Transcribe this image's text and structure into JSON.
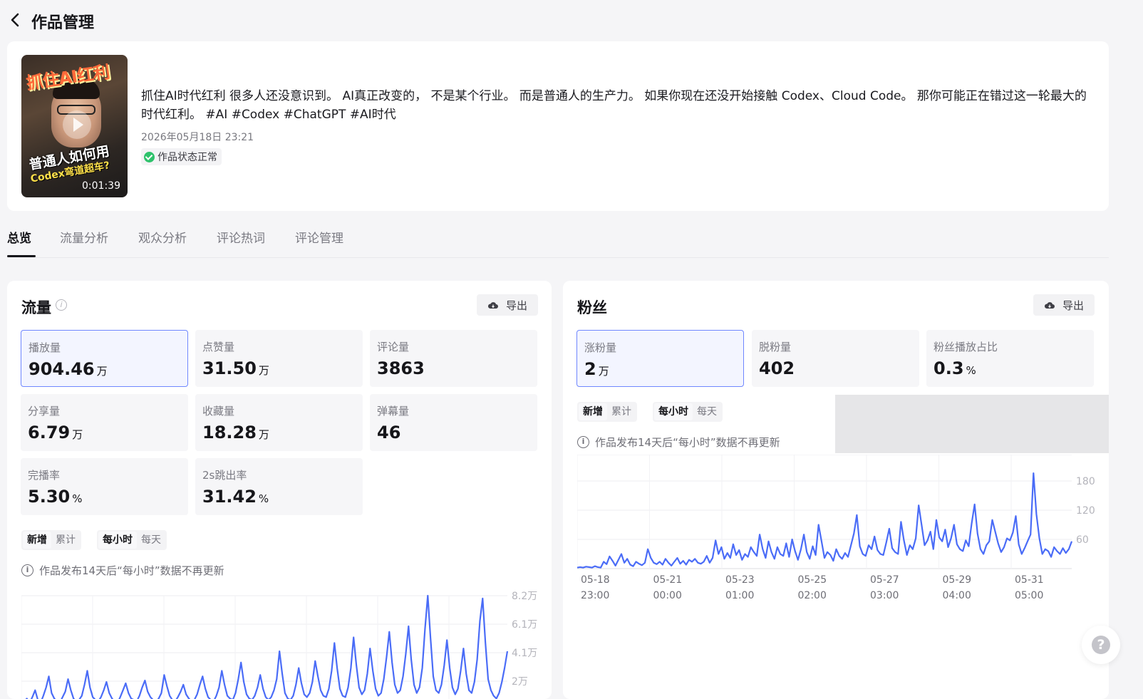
{
  "header": {
    "title": "作品管理"
  },
  "video": {
    "thumbnail": {
      "line1": "抓住AI红利",
      "line2": "普通人如何用",
      "line3": "Codex弯道超车?",
      "duration": "0:01:39"
    },
    "description": "抓住AI时代红利 很多人还没意识到。 AI真正改变的， 不是某个行业。 而是普通人的生产力。 如果你现在还没开始接触 Codex、Cloud Code。 那你可能正在错过这一轮最大的时代红利。 #AI #Codex #ChatGPT #AI时代",
    "published_at": "2026年05月18日 23:21",
    "status": "作品状态正常"
  },
  "tabs": [
    "总览",
    "流量分析",
    "观众分析",
    "评论热词",
    "评论管理"
  ],
  "traffic": {
    "title": "流量",
    "export_label": "导出",
    "metrics": [
      {
        "label": "播放量",
        "value": "904.46",
        "unit": "万"
      },
      {
        "label": "点赞量",
        "value": "31.50",
        "unit": "万"
      },
      {
        "label": "评论量",
        "value": "3863",
        "unit": ""
      },
      {
        "label": "分享量",
        "value": "6.79",
        "unit": "万"
      },
      {
        "label": "收藏量",
        "value": "18.28",
        "unit": "万"
      },
      {
        "label": "弹幕量",
        "value": "46",
        "unit": ""
      },
      {
        "label": "完播率",
        "value": "5.30",
        "unit": "%"
      },
      {
        "label": "2s跳出率",
        "value": "31.42",
        "unit": "%"
      }
    ],
    "toggle_mode": [
      "新增",
      "累计"
    ],
    "toggle_period": [
      "每小时",
      "每天"
    ],
    "notice": "作品发布14天后“每小时”数据不再更新"
  },
  "fans": {
    "title": "粉丝",
    "export_label": "导出",
    "metrics": [
      {
        "label": "涨粉量",
        "value": "2",
        "unit": "万"
      },
      {
        "label": "脱粉量",
        "value": "402",
        "unit": ""
      },
      {
        "label": "粉丝播放占比",
        "value": "0.3",
        "unit": "%"
      }
    ],
    "toggle_mode": [
      "新增",
      "累计"
    ],
    "toggle_period": [
      "每小时",
      "每天"
    ],
    "notice": "作品发布14天后“每小时”数据不再更新"
  },
  "chart_data": [
    {
      "type": "line",
      "y_ticks": [
        "8.2万",
        "6.1万",
        "4.1万",
        "2万"
      ],
      "ylim": [
        0,
        82000
      ],
      "grid": true,
      "color": "#4a6cf7",
      "values": [
        3,
        6,
        8,
        5,
        9,
        14,
        7,
        5,
        10,
        16,
        24,
        12,
        8,
        6,
        5,
        9,
        13,
        22,
        14,
        8,
        6,
        7,
        10,
        18,
        28,
        16,
        9,
        7,
        6,
        9,
        14,
        20,
        12,
        8,
        6,
        5,
        9,
        14,
        19,
        12,
        8,
        7,
        6,
        10,
        16,
        21,
        13,
        9,
        7,
        6,
        8,
        12,
        25,
        17,
        10,
        7,
        6,
        9,
        13,
        18,
        11,
        8,
        6,
        7,
        11,
        18,
        24,
        15,
        9,
        7,
        6,
        10,
        16,
        28,
        18,
        10,
        8,
        7,
        12,
        22,
        34,
        20,
        11,
        8,
        7,
        10,
        16,
        25,
        15,
        9,
        7,
        9,
        14,
        22,
        42,
        26,
        12,
        8,
        7,
        10,
        18,
        30,
        19,
        11,
        9,
        12,
        20,
        35,
        24,
        14,
        10,
        9,
        15,
        28,
        48,
        30,
        15,
        10,
        9,
        16,
        30,
        52,
        32,
        16,
        11,
        14,
        26,
        44,
        28,
        15,
        10,
        12,
        22,
        38,
        56,
        34,
        18,
        12,
        14,
        24,
        40,
        60,
        36,
        18,
        12,
        16,
        30,
        58,
        82,
        52,
        24,
        14,
        12,
        18,
        32,
        50,
        30,
        16,
        11,
        15,
        28,
        44,
        26,
        14,
        12,
        20,
        36,
        64,
        80,
        48,
        22,
        14,
        10,
        8,
        12,
        20,
        30,
        42
      ]
    },
    {
      "type": "line",
      "x_ticks": [
        "05-18 23:00",
        "05-21 00:00",
        "05-23 01:00",
        "05-25 02:00",
        "05-27 03:00",
        "05-29 04:00",
        "05-31 05:00"
      ],
      "y_ticks": [
        "180",
        "120",
        "60"
      ],
      "ylim": [
        0,
        200
      ],
      "grid": true,
      "color": "#4a6cf7",
      "values": [
        2,
        3,
        2,
        4,
        3,
        2,
        5,
        3,
        2,
        14,
        9,
        25,
        16,
        6,
        18,
        30,
        12,
        20,
        8,
        5,
        14,
        10,
        7,
        12,
        40,
        22,
        12,
        9,
        14,
        8,
        20,
        12,
        6,
        14,
        22,
        10,
        16,
        8,
        18,
        14,
        20,
        12,
        10,
        14,
        26,
        12,
        22,
        58,
        30,
        44,
        20,
        32,
        22,
        50,
        28,
        38,
        18,
        30,
        24,
        44,
        34,
        26,
        70,
        40,
        22,
        56,
        34,
        20,
        44,
        30,
        26,
        52,
        24,
        60,
        36,
        18,
        40,
        70,
        34,
        20,
        46,
        28,
        90,
        56,
        22,
        34,
        28,
        16,
        40,
        26,
        20,
        32,
        24,
        48,
        72,
        110,
        46,
        30,
        26,
        48,
        40,
        66,
        38,
        30,
        28,
        54,
        82,
        42,
        34,
        30,
        96,
        58,
        28,
        48,
        40,
        62,
        130,
        90,
        48,
        58,
        76,
        40,
        100,
        64,
        56,
        80,
        44,
        62,
        90,
        50,
        40,
        36,
        58,
        46,
        92,
        132,
        72,
        40,
        30,
        48,
        56,
        100,
        76,
        52,
        34,
        44,
        62,
        58,
        74,
        108,
        50,
        30,
        42,
        56,
        70,
        196,
        112,
        62,
        30,
        40,
        36,
        24,
        44,
        36,
        30,
        42,
        32,
        40,
        56
      ]
    }
  ]
}
